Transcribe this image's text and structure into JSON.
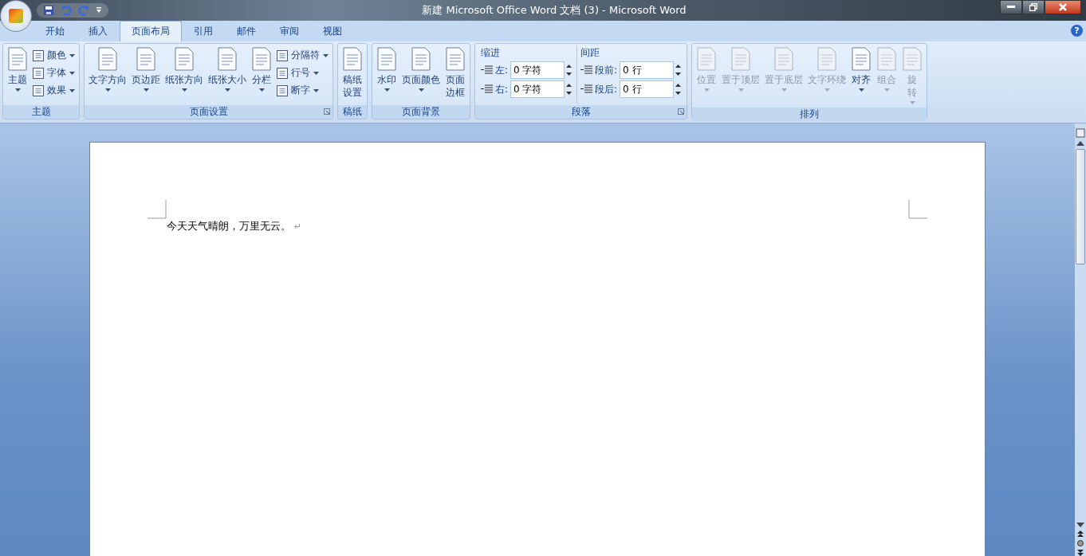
{
  "window": {
    "title": "新建 Microsoft Office Word 文档 (3) - Microsoft Word"
  },
  "ribbon": {
    "tabs": [
      {
        "label": "开始",
        "selected": false
      },
      {
        "label": "插入",
        "selected": false
      },
      {
        "label": "页面布局",
        "selected": true
      },
      {
        "label": "引用",
        "selected": false
      },
      {
        "label": "邮件",
        "selected": false
      },
      {
        "label": "审阅",
        "selected": false
      },
      {
        "label": "视图",
        "selected": false
      }
    ],
    "groups": [
      {
        "label": "主题",
        "launcher": false,
        "items": [
          {
            "kind": "large",
            "label": "主题",
            "dropdown": true,
            "disabled": false
          },
          {
            "kind": "stack",
            "items": [
              {
                "label": "颜色",
                "dropdown": true
              },
              {
                "label": "字体",
                "dropdown": true
              },
              {
                "label": "效果",
                "dropdown": true
              }
            ]
          }
        ]
      },
      {
        "label": "页面设置",
        "launcher": true,
        "items": [
          {
            "kind": "large",
            "label": "文字方向",
            "dropdown": true,
            "disabled": false
          },
          {
            "kind": "large",
            "label": "页边距",
            "dropdown": true,
            "disabled": false
          },
          {
            "kind": "large",
            "label": "纸张方向",
            "dropdown": true,
            "disabled": false
          },
          {
            "kind": "large",
            "label": "纸张大小",
            "dropdown": true,
            "disabled": false
          },
          {
            "kind": "large",
            "label": "分栏",
            "dropdown": true,
            "disabled": false
          },
          {
            "kind": "stack",
            "items": [
              {
                "label": "分隔符",
                "dropdown": true
              },
              {
                "label": "行号",
                "dropdown": true
              },
              {
                "label": "断字",
                "dropdown": true
              }
            ]
          }
        ]
      },
      {
        "label": "稿纸",
        "launcher": false,
        "items": [
          {
            "kind": "large",
            "label": "稿纸设置",
            "two_line": true,
            "dropdown": false,
            "disabled": false
          }
        ]
      },
      {
        "label": "页面背景",
        "launcher": false,
        "items": [
          {
            "kind": "large",
            "label": "水印",
            "dropdown": true,
            "disabled": false
          },
          {
            "kind": "large",
            "label": "页面颜色",
            "dropdown": true,
            "disabled": false
          },
          {
            "kind": "large",
            "label": "页面边框",
            "two_line": true,
            "dropdown": false,
            "disabled": false
          }
        ]
      },
      {
        "label": "段落",
        "launcher": true,
        "items": [
          {
            "kind": "spinners",
            "heading": "缩进",
            "fields": [
              {
                "label": "左:",
                "value": "0 字符"
              },
              {
                "label": "右:",
                "value": "0 字符"
              }
            ]
          },
          {
            "kind": "spinners",
            "heading": "间距",
            "fields": [
              {
                "label": "段前:",
                "value": "0 行"
              },
              {
                "label": "段后:",
                "value": "0 行"
              }
            ]
          }
        ]
      },
      {
        "label": "排列",
        "launcher": false,
        "items": [
          {
            "kind": "large",
            "label": "位置",
            "dropdown": true,
            "disabled": true
          },
          {
            "kind": "large",
            "label": "置于顶层",
            "dropdown": true,
            "disabled": true
          },
          {
            "kind": "large",
            "label": "置于底层",
            "dropdown": true,
            "disabled": true
          },
          {
            "kind": "large",
            "label": "文字环绕",
            "dropdown": true,
            "disabled": true
          },
          {
            "kind": "large",
            "label": "对齐",
            "dropdown": true,
            "disabled": false
          },
          {
            "kind": "large",
            "label": "组合",
            "dropdown": true,
            "disabled": true
          },
          {
            "kind": "large",
            "label": "旋转",
            "two_line": true,
            "dropdown": true,
            "disabled": true
          }
        ]
      }
    ],
    "help_button": "?"
  },
  "document": {
    "paragraph": "今天天气晴朗，万里无云。",
    "paragraph_mark": "↵"
  }
}
